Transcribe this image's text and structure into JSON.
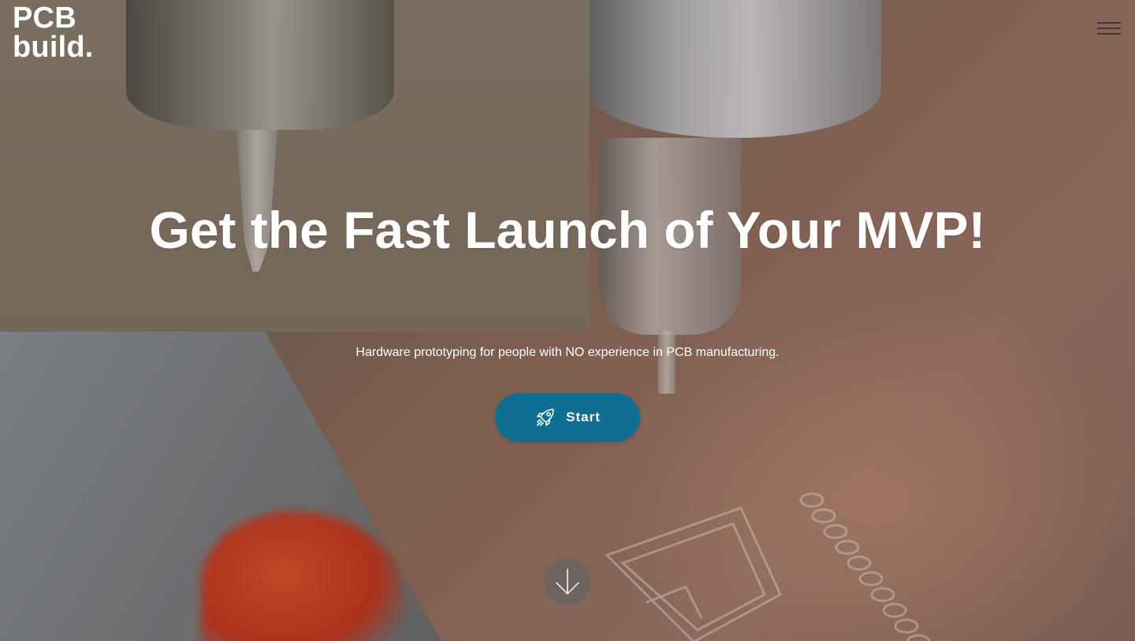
{
  "header": {
    "logo_line1": "PCB",
    "logo_line2": "build."
  },
  "hero": {
    "headline": "Get the Fast Launch of Your MVP!",
    "subheadline": "Hardware prototyping for people with NO experience in PCB manufacturing.",
    "cta_label": "Start"
  },
  "icons": {
    "menu": "hamburger-menu-icon",
    "cta": "rocket-icon",
    "scroll": "arrow-down-icon"
  },
  "colors": {
    "cta_background": "#0f6f93",
    "text": "#ffffff",
    "menu_lines": "#3a3a3a"
  }
}
